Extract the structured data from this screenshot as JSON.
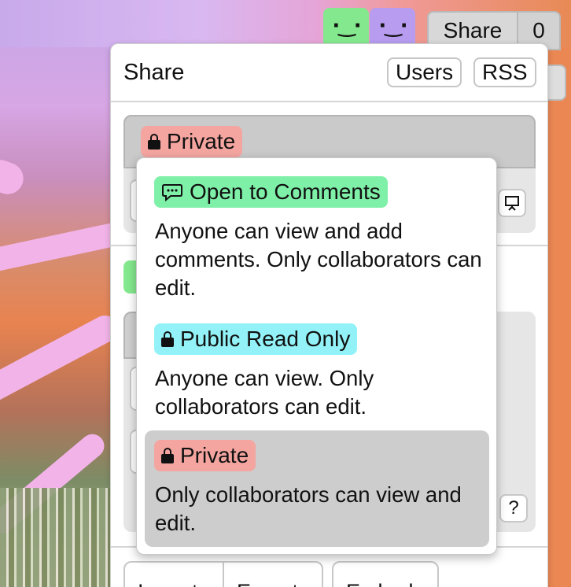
{
  "topbar": {
    "avatars": [
      {
        "face": "·‿·",
        "color": "#84e98e"
      },
      {
        "face": "·‿·",
        "color": "#b79cf0"
      }
    ],
    "share_label": "Share",
    "share_count": "0"
  },
  "share_panel": {
    "title": "Share",
    "users_label": "Users",
    "rss_label": "RSS",
    "current_visibility": "Private",
    "help_label": "?",
    "bottom_buttons": {
      "import": "Import",
      "export": "Export",
      "embed": "Embed"
    }
  },
  "visibility_menu": {
    "options": [
      {
        "label": "Open to Comments",
        "description": "Anyone can view and add comments. Only collaborators can edit.",
        "icon": "comment-icon",
        "color": "#7ff0a8",
        "selected": false
      },
      {
        "label": "Public Read Only",
        "description": "Anyone can view. Only collaborators can edit.",
        "icon": "lock-icon",
        "color": "#92f2f7",
        "selected": false
      },
      {
        "label": "Private",
        "description": "Only collaborators can view and edit.",
        "icon": "lock-icon",
        "color": "#f4a5a0",
        "selected": true
      }
    ]
  }
}
